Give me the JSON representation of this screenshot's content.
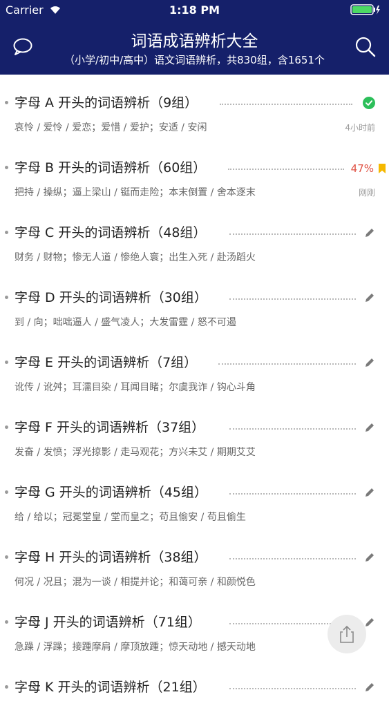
{
  "status_bar": {
    "carrier": "Carrier",
    "time": "1:18 PM"
  },
  "header": {
    "title": "词语成语辨析大全",
    "subtitle": "（小学/初中/高中）语文词语辨析，共830组，含1651个"
  },
  "colors": {
    "header_bg": "#15206a",
    "done": "#2cbf5a",
    "progress": "#e05244",
    "bookmark": "#f5b800",
    "edit_icon": "#7a7a7a"
  },
  "rows": [
    {
      "title": "字母 A 开头的词语辨析（9组）",
      "words": "哀怜 / 爱怜 / 爱恋；爱惜 / 爱护；安适 / 安闲",
      "time": "4小时前",
      "status": "done-icon"
    },
    {
      "title": "字母 B 开头的词语辨析（60组）",
      "words": "把持 / 操纵；逼上梁山 / 铤而走险；本末倒置 / 舍本逐末",
      "time": "刚刚",
      "progress": "47%",
      "status": "bookmark-icon"
    },
    {
      "title": "字母 C 开头的词语辨析（48组）",
      "words": "财务 / 财物；惨无人道 / 惨绝人寰；出生入死 / 赴汤蹈火",
      "status": "pencil-icon"
    },
    {
      "title": "字母 D 开头的词语辨析（30组）",
      "words": "到 / 向；咄咄逼人 / 盛气凌人；大发雷霆 / 怒不可遏",
      "status": "pencil-icon"
    },
    {
      "title": "字母 E 开头的词语辨析（7组）",
      "words": "讹传 / 讹舛；耳濡目染 / 耳闻目睹；尔虞我诈 / 钩心斗角",
      "status": "pencil-icon"
    },
    {
      "title": "字母 F 开头的词语辨析（37组）",
      "words": "发奋 / 发愤；浮光掠影 / 走马观花；方兴未艾 / 期期艾艾",
      "status": "pencil-icon"
    },
    {
      "title": "字母 G 开头的词语辨析（45组）",
      "words": "给 / 给以；冠冕堂皇 / 堂而皇之；苟且偷安 / 苟且偷生",
      "status": "pencil-icon"
    },
    {
      "title": "字母 H 开头的词语辨析（38组）",
      "words": "何况 / 况且；混为一谈 / 相提并论；和蔼可亲 / 和颜悦色",
      "status": "pencil-icon"
    },
    {
      "title": "字母 J 开头的词语辨析（71组）",
      "words": "急躁 / 浮躁；接踵摩肩 / 摩顶放踵；惊天动地 / 撼天动地",
      "status": "pencil-icon"
    },
    {
      "title": "字母 K 开头的词语辨析（21组）",
      "words": "",
      "status": "pencil-icon"
    }
  ]
}
